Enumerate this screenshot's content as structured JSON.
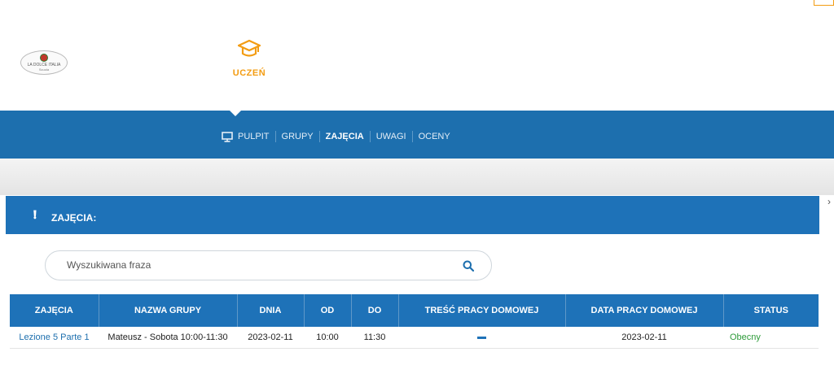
{
  "logo": {
    "line1": "LA DOLCE ITALIA",
    "line2": "Scuola"
  },
  "role": {
    "label": "UCZEŃ",
    "icon": "graduation-cap-icon",
    "color": "#f39c12"
  },
  "nav": {
    "items": [
      {
        "label": "PULPIT",
        "icon": "monitor-icon"
      },
      {
        "label": "GRUPY"
      },
      {
        "label": "ZAJĘCIA",
        "active": true
      },
      {
        "label": "UWAGI"
      },
      {
        "label": "OCENY"
      }
    ],
    "color": "#1d6fae"
  },
  "panel": {
    "title": "ZAJĘCIA:"
  },
  "search": {
    "placeholder": "Wyszukiwana fraza"
  },
  "table": {
    "columns": [
      "ZAJĘCIA",
      "NAZWA GRUPY",
      "DNIA",
      "OD",
      "DO",
      "TREŚĆ PRACY DOMOWEJ",
      "DATA PRACY DOMOWEJ",
      "STATUS"
    ],
    "rows": [
      {
        "zajecia": "Lezione 5 Parte 1",
        "grupa": "Mateusz - Sobota 10:00-11:30",
        "dnia": "2023-02-11",
        "od": "10:00",
        "do": "11:30",
        "data_pracy": "2023-02-11",
        "status": "Obecny"
      }
    ]
  },
  "side": {
    "chevron": "›"
  }
}
